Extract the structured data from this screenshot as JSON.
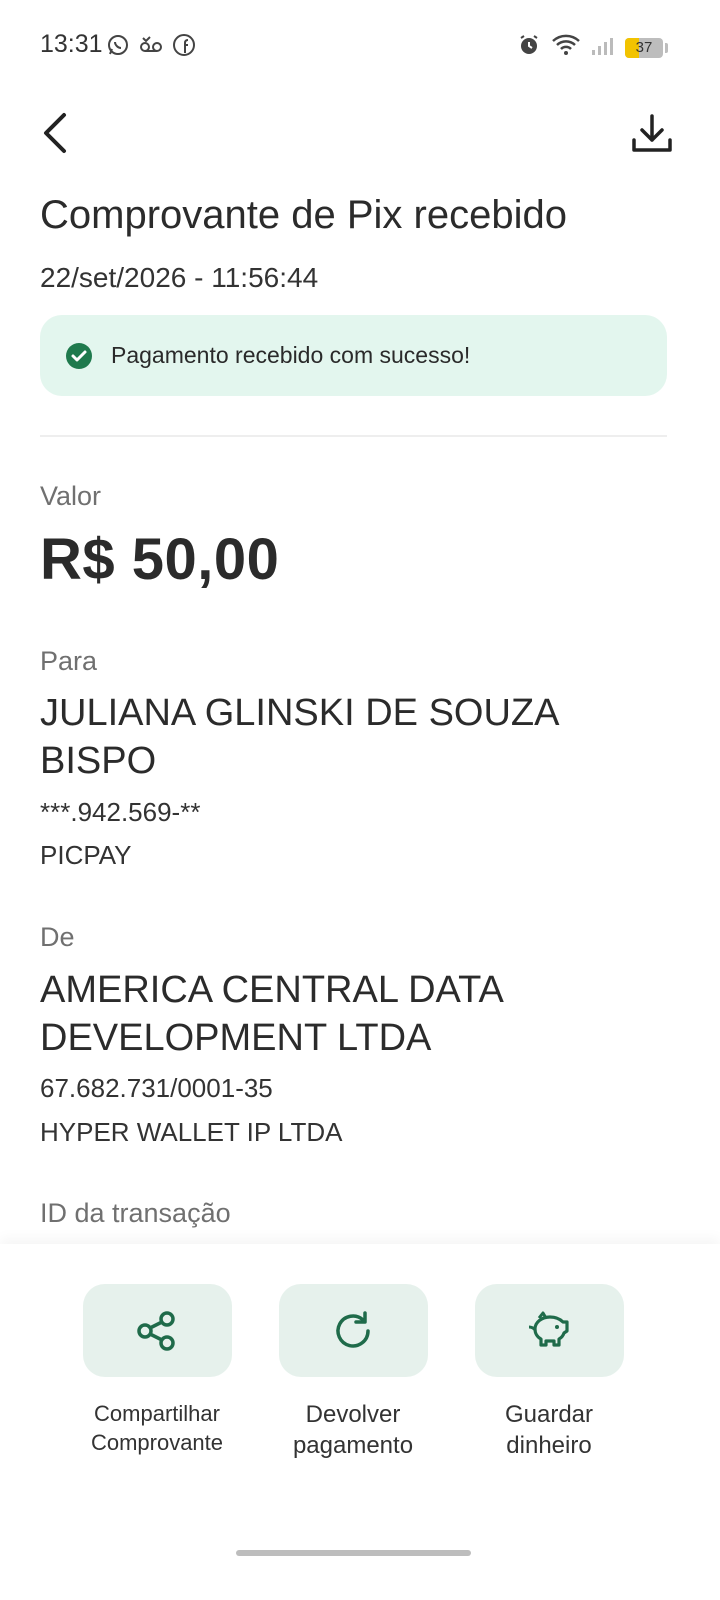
{
  "status_bar": {
    "time": "13:31",
    "left_icons": [
      "whatsapp-icon",
      "voicemail-icon",
      "facebook-icon"
    ],
    "right_icons": [
      "alarm-icon",
      "wifi-icon",
      "signal-icon"
    ],
    "battery_level": "37",
    "battery_fraction": 0.37
  },
  "header": {
    "back_icon": "chevron-left-icon",
    "download_icon": "download-icon",
    "title": "Comprovante de Pix recebido",
    "datetime": "22/set/2026 - 11:56:44"
  },
  "banner": {
    "text": "Pagamento recebido com sucesso!",
    "icon": "check-circle-icon",
    "background": "#e3f6ee",
    "icon_color": "#1f7a4d"
  },
  "valor": {
    "label": "Valor",
    "amount": "R$ 50,00"
  },
  "para": {
    "label": "Para",
    "name": "JULIANA GLINSKI DE SOUZA BISPO",
    "document": "***.942.569-**",
    "institution": "PICPAY"
  },
  "de": {
    "label": "De",
    "name": "AMERICA CENTRAL DATA DEVELOPMENT LTDA",
    "document": "67.682.731/0001-35",
    "institution": "HYPER WALLET IP LTDA"
  },
  "transaction": {
    "label": "ID da transação"
  },
  "actions": [
    {
      "line1": "Compartilhar",
      "line2": "Comprovante",
      "icon": "share-icon"
    },
    {
      "line1": "Devolver",
      "line2": "pagamento",
      "icon": "refresh-icon"
    },
    {
      "line1": "Guardar",
      "line2": "dinheiro",
      "icon": "piggy-bank-icon"
    }
  ],
  "colors": {
    "accent": "#1f6b4a",
    "tile_background": "#e6f1ec"
  }
}
